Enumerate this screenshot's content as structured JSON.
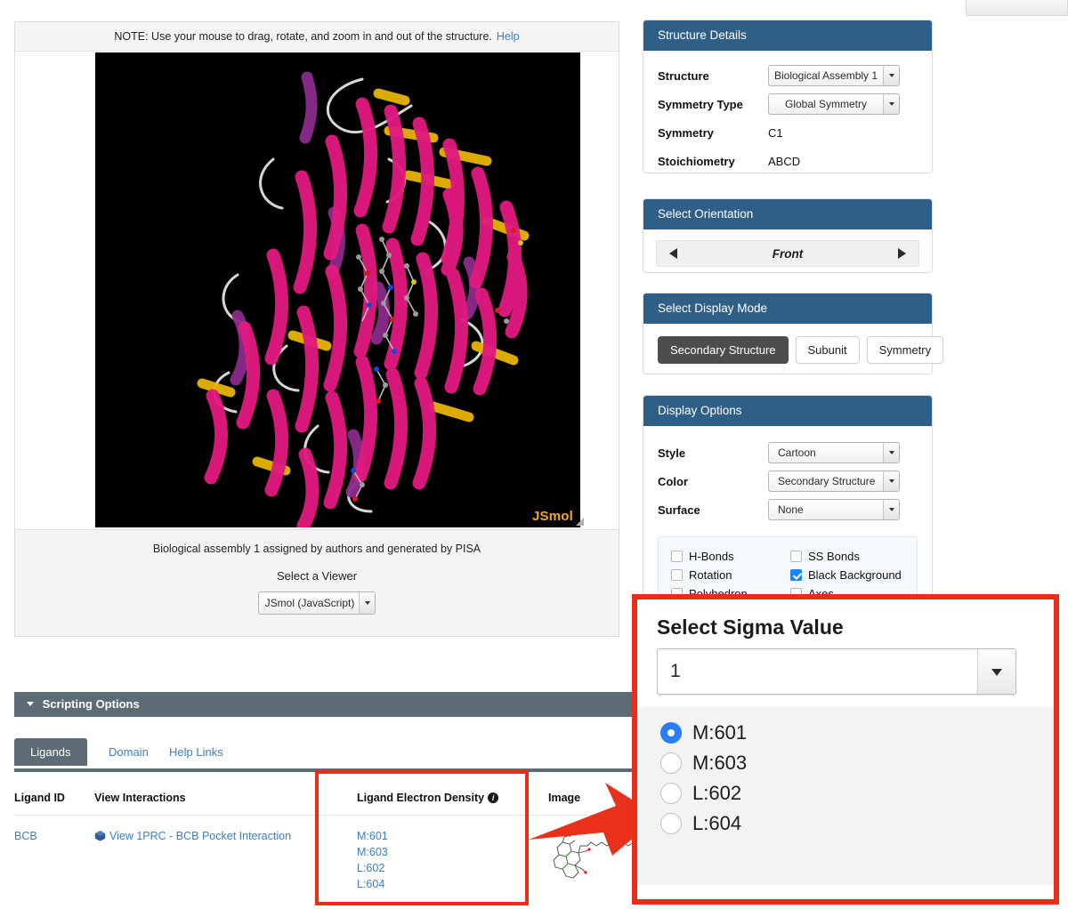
{
  "viewer": {
    "note_text": "NOTE: Use your mouse to drag, rotate, and zoom in and out of the structure.",
    "note_help_label": "Help",
    "watermark": "JSmol",
    "assembly_caption": "Biological assembly 1 assigned by authors and generated by PISA",
    "select_viewer_label": "Select a Viewer",
    "viewer_value": "JSmol (JavaScript)"
  },
  "structure_details": {
    "header": "Structure Details",
    "structure_label": "Structure",
    "structure_value": "Biological Assembly 1",
    "symmetry_type_label": "Symmetry Type",
    "symmetry_type_value": "Global Symmetry",
    "symmetry_label": "Symmetry",
    "symmetry_value": "C1",
    "stoichiometry_label": "Stoichiometry",
    "stoichiometry_value": "ABCD"
  },
  "orientation": {
    "header": "Select Orientation",
    "current": "Front"
  },
  "display_mode": {
    "header": "Select Display Mode",
    "buttons": [
      {
        "label": "Secondary Structure",
        "active": true
      },
      {
        "label": "Subunit",
        "active": false
      },
      {
        "label": "Symmetry",
        "active": false
      }
    ]
  },
  "display_options": {
    "header": "Display Options",
    "style_label": "Style",
    "style_value": "Cartoon",
    "color_label": "Color",
    "color_value": "Secondary Structure",
    "surface_label": "Surface",
    "surface_value": "None",
    "checkboxes": [
      {
        "label": "H-Bonds",
        "checked": false
      },
      {
        "label": "SS Bonds",
        "checked": false
      },
      {
        "label": "Rotation",
        "checked": false
      },
      {
        "label": "Black Background",
        "checked": true
      },
      {
        "label": "Polyhedron",
        "checked": false
      },
      {
        "label": "Axes",
        "checked": false
      }
    ]
  },
  "scripting": {
    "header": "Scripting Options"
  },
  "tabs": [
    {
      "label": "Ligands",
      "active": true
    },
    {
      "label": "Domain",
      "active": false
    },
    {
      "label": "Help Links",
      "active": false
    }
  ],
  "ligand_table": {
    "columns": [
      "Ligand ID",
      "View Interactions",
      "Ligand Electron Density",
      "Image"
    ],
    "rows": [
      {
        "ligand_id": "BCB",
        "interaction_link": "View 1PRC - BCB Pocket Interaction",
        "electron_density": [
          "M:601",
          "M:603",
          "L:602",
          "L:604"
        ]
      }
    ]
  },
  "sigma_popup": {
    "title": "Select Sigma Value",
    "selected_value": "1",
    "options": [
      {
        "label": "M:601",
        "selected": true
      },
      {
        "label": "M:603",
        "selected": false
      },
      {
        "label": "L:602",
        "selected": false
      },
      {
        "label": "L:604",
        "selected": false
      }
    ]
  },
  "colors": {
    "panel_header": "#2f5f86",
    "scripting_bar": "#5d6b74",
    "annotation_red": "#eb2d17",
    "link_blue": "#3d7ebf",
    "accent_selected": "#2b7cf7"
  }
}
